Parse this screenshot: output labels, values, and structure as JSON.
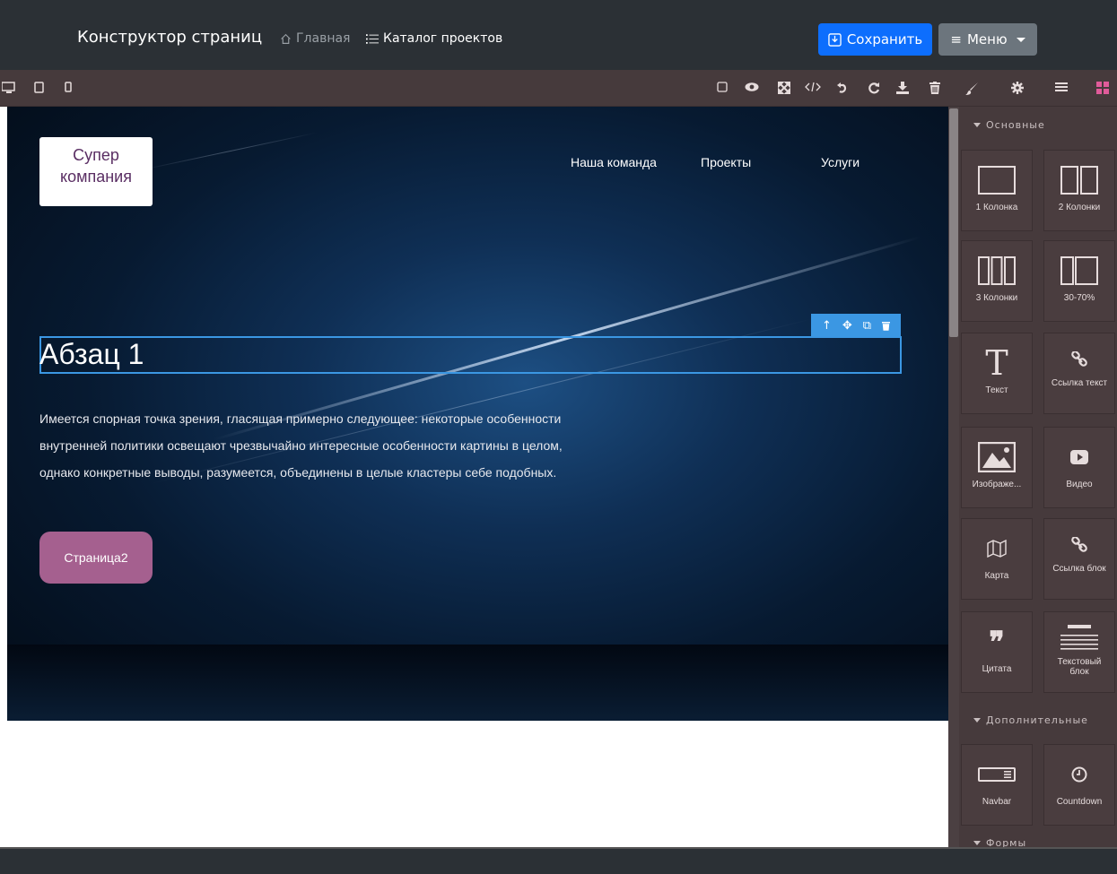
{
  "header": {
    "brand": "Конструктор страниц",
    "home_label": "Главная",
    "catalog_label": "Каталог проектов",
    "save_label": "Сохранить",
    "menu_label": "Меню"
  },
  "toolbar": {
    "devices": [
      "desktop-icon",
      "tablet-icon",
      "mobile-icon"
    ],
    "actions": [
      "square-icon",
      "eye-icon",
      "fullscreen-icon",
      "code-icon",
      "undo-icon",
      "redo-icon",
      "download-icon",
      "trash-icon"
    ],
    "panels": [
      "brush-icon",
      "gear-icon",
      "layers-icon",
      "blocks-icon"
    ],
    "active_panel_color": "#e05b9a"
  },
  "page": {
    "logo_line1": "Супер",
    "logo_line2": "компания",
    "nav": [
      "Наша команда",
      "Проекты",
      "Услуги"
    ],
    "heading": "Абзац 1",
    "paragraph": "Имеется спорная точка зрения, гласящая примерно следующее: некоторые особенности внутренней политики освещают чрезвычайно интересные особенности картины в целом, однако конкретные выводы, разумеется, объединены в целые кластеры себе подобных.",
    "button": "Страница2",
    "button_color": "#a5608f",
    "selection_color": "#3b97e3"
  },
  "blocks_panel": {
    "categories": [
      {
        "title": "Основные",
        "items": [
          {
            "label": "1 Колонка",
            "icon": "one-column-icon"
          },
          {
            "label": "2 Колонки",
            "icon": "two-columns-icon"
          },
          {
            "label": "3 Колонки",
            "icon": "three-columns-icon"
          },
          {
            "label": "30-70%",
            "icon": "split-30-70-icon"
          },
          {
            "label": "Текст",
            "icon": "text-icon"
          },
          {
            "label": "Ссылка текст",
            "icon": "link-icon"
          },
          {
            "label": "Изображе...",
            "icon": "image-icon"
          },
          {
            "label": "Видео",
            "icon": "video-icon"
          },
          {
            "label": "Карта",
            "icon": "map-icon"
          },
          {
            "label": "Ссылка блок",
            "icon": "link-block-icon"
          },
          {
            "label": "Цитата",
            "icon": "quote-icon"
          },
          {
            "label": "Текстовый блок",
            "icon": "text-block-icon"
          }
        ]
      },
      {
        "title": "Дополнительные",
        "items": [
          {
            "label": "Navbar",
            "icon": "navbar-icon"
          },
          {
            "label": "Countdown",
            "icon": "clock-icon"
          }
        ]
      },
      {
        "title": "Формы",
        "items": []
      }
    ]
  }
}
